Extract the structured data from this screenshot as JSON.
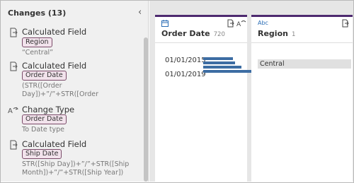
{
  "changes": {
    "header": "Changes (13)",
    "items": [
      {
        "icon": "calculated-field-icon",
        "title": "Calculated Field",
        "field": "Region",
        "desc": "“Central”"
      },
      {
        "icon": "calculated-field-icon",
        "title": "Calculated Field",
        "field": "Order Date",
        "desc": "(STR([Order\nDay])+”/”+STR([Order"
      },
      {
        "icon": "change-type-icon",
        "title": "Change Type",
        "field": "Order Date",
        "desc": "To Date type"
      },
      {
        "icon": "calculated-field-icon",
        "title": "Calculated Field",
        "field": "Ship Date",
        "desc": "STR([Ship Day])+”/”+STR([Ship\nMonth])+”/”+STR([Ship Year])"
      }
    ]
  },
  "cards": [
    {
      "type_icon": "calendar-icon",
      "name": "Order Date",
      "count": "720",
      "date_labels": [
        "01/01/2015",
        "01/01/2019"
      ],
      "bar_values": [
        0.59,
        0.63,
        0.76,
        0.98
      ]
    },
    {
      "type_icon": "Abc",
      "name": "Region",
      "count": "1",
      "values": [
        "Central"
      ]
    }
  ],
  "colors": {
    "accent": "#4e2a6f",
    "pill_fill": "#f2e3ec",
    "pill_border": "#7a4b69",
    "bar": "#3d6da3"
  }
}
